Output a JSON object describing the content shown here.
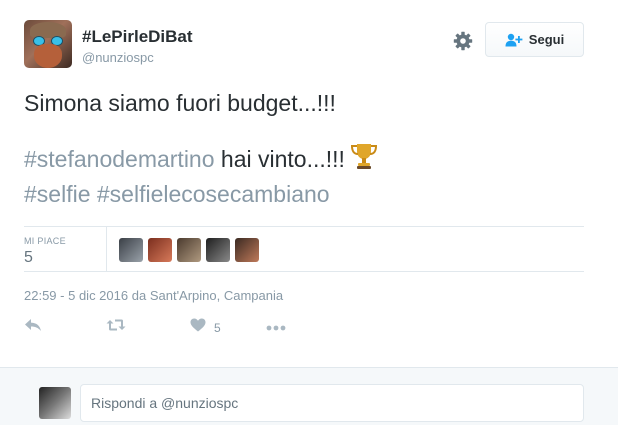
{
  "user": {
    "name": "#LePirleDiBat",
    "handle": "@nunziospc"
  },
  "follow_button": {
    "label": "Segui"
  },
  "tweet": {
    "line1": "Simona siamo fuori budget...!!!",
    "hashtag1": "#stefanodemartino",
    "line2_rest": " hai vinto...!!!",
    "hashtag2": "#selfie",
    "hashtag3": "#selfielecosecambiano",
    "emoji": "trophy-icon"
  },
  "stats": {
    "likes_label": "MI PIACE",
    "likes_count": "5",
    "liker_avatar_colors": [
      "#5a5f66",
      "#a8513c",
      "#6e5a4a",
      "#3b3b3b",
      "#7a4a3c"
    ]
  },
  "meta": {
    "time": "22:59",
    "date": "5 dic 2016",
    "da": "da",
    "place": "Sant'Arpino, Campania"
  },
  "actions": {
    "like_count": "5"
  },
  "reply": {
    "placeholder": "Rispondi a @nunziospc"
  },
  "colors": {
    "text": "#292f33",
    "muted": "#8899a6",
    "border": "#e1e8ed",
    "icon": "#aab8c2"
  }
}
